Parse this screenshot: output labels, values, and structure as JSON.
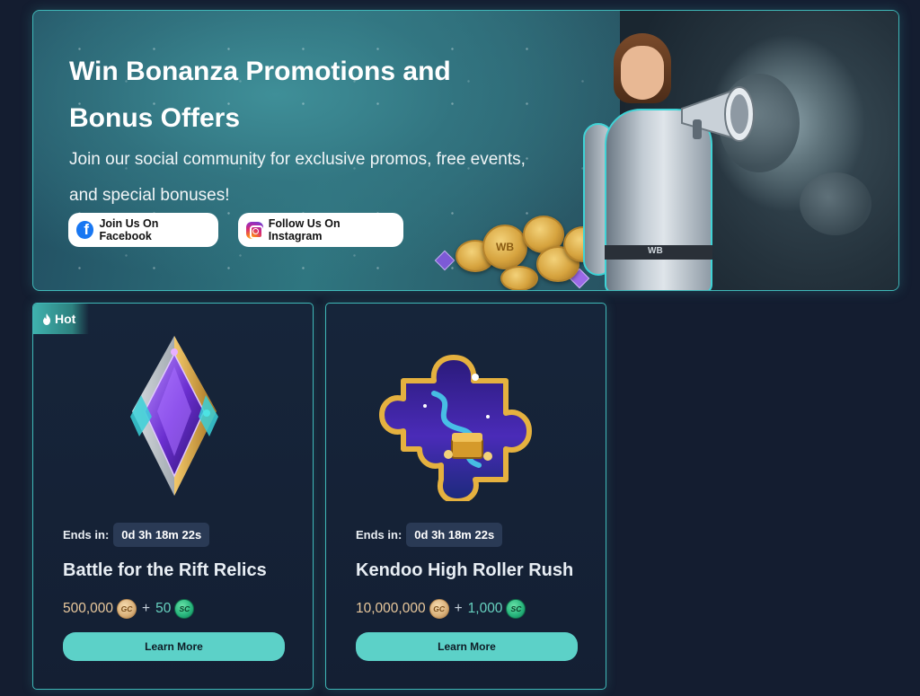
{
  "hero": {
    "title": "Win Bonanza Promotions and Bonus Offers",
    "subtitle": "Join our social community for exclusive promos, free events, and special bonuses!",
    "facebook_button": "Join Us On Facebook",
    "instagram_button": "Follow Us On Instagram",
    "coin_mark": "WB",
    "belt_mark": "WB"
  },
  "promotions": [
    {
      "badge": "Hot",
      "ends_label": "Ends in:",
      "timer": "0d 3h 18m 22s",
      "title": "Battle for the Rift Relics",
      "gc_amount": "500,000",
      "gc_symbol": "GC",
      "plus": "+",
      "sc_amount": "50",
      "sc_symbol": "SC",
      "button": "Learn More",
      "art_icon": "crystal-gem-icon"
    },
    {
      "ends_label": "Ends in:",
      "timer": "0d 3h 18m 22s",
      "title": "Kendoo High Roller Rush",
      "gc_amount": "10,000,000",
      "gc_symbol": "GC",
      "plus": "+",
      "sc_amount": "1,000",
      "sc_symbol": "SC",
      "button": "Learn More",
      "art_icon": "puzzle-piece-icon"
    }
  ],
  "colors": {
    "page_bg": "#141d30",
    "accent": "#5cd1c8",
    "border": "#3fb8b8",
    "timer_bg": "#2a3a55",
    "facebook": "#1877f2"
  }
}
